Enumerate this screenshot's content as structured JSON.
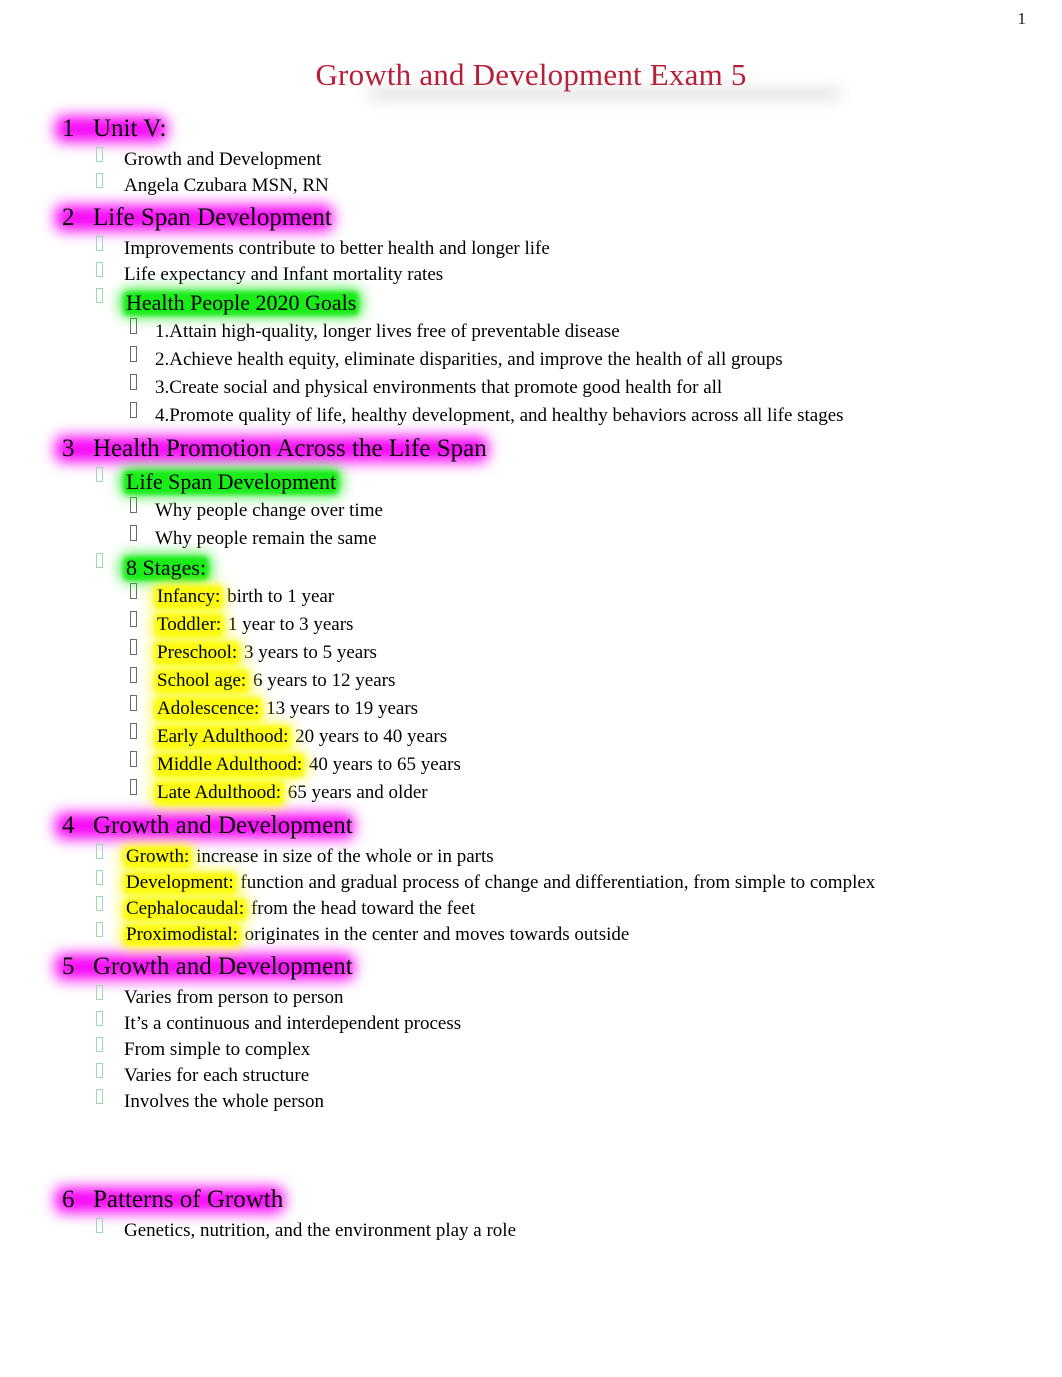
{
  "page": {
    "number": "1",
    "title": "Growth and Development Exam 5",
    "title_color": "#b81e38",
    "highlight_colors": {
      "magenta": "#FF00FF",
      "green": "#00FF00",
      "yellow": "#FFFF00"
    }
  },
  "sections": [
    {
      "number": "1",
      "heading": "Unit V:",
      "heading_highlight": "magenta",
      "items": [
        {
          "level": 2,
          "text": "Growth and Development"
        },
        {
          "level": 2,
          "text": "Angela Czubara MSN, RN"
        }
      ]
    },
    {
      "number": "2",
      "heading": "Life Span Development",
      "heading_highlight": "magenta",
      "items": [
        {
          "level": 2,
          "text": "Improvements contribute to better health and longer life"
        },
        {
          "level": 2,
          "text": "Life expectancy and Infant mortality rates"
        },
        {
          "level": 2,
          "text": "Health People 2020 Goals",
          "highlight": "green",
          "big": true
        },
        {
          "level": 3,
          "text": "1.Attain high-quality, longer lives free of preventable disease"
        },
        {
          "level": 3,
          "text": "2.Achieve health equity, eliminate disparities, and improve the health of all groups"
        },
        {
          "level": 3,
          "text": "3.Create social and physical environments that promote good health for all"
        },
        {
          "level": 3,
          "text": "4.Promote quality of life, healthy development, and healthy behaviors across all life stages"
        }
      ]
    },
    {
      "number": "3",
      "heading": "Health Promotion Across the Life Span",
      "heading_highlight": "magenta",
      "items": [
        {
          "level": 2,
          "text": "Life Span Development",
          "highlight": "green",
          "big": true
        },
        {
          "level": 3,
          "text": "Why people change over time"
        },
        {
          "level": 3,
          "text": "Why people remain the same"
        },
        {
          "level": 2,
          "text": "8 Stages:",
          "highlight": "green",
          "big": true
        },
        {
          "level": 3,
          "term": "Infancy:",
          "term_highlight": "yellow",
          "rest": " birth to 1 year"
        },
        {
          "level": 3,
          "term": "Toddler:",
          "term_highlight": "yellow",
          "rest": "  1 year to 3 years"
        },
        {
          "level": 3,
          "term": "Preschool:",
          "term_highlight": "yellow",
          "rest": "  3 years to 5 years"
        },
        {
          "level": 3,
          "term": "School age:",
          "term_highlight": "yellow",
          "rest": " 6 years to 12 years"
        },
        {
          "level": 3,
          "term": "Adolescence:",
          "term_highlight": "yellow",
          "rest": " 13 years to 19 years"
        },
        {
          "level": 3,
          "term": "Early Adulthood:",
          "term_highlight": "yellow",
          "rest": " 20 years to 40 years"
        },
        {
          "level": 3,
          "term": "Middle Adulthood:",
          "term_highlight": "yellow",
          "rest": "  40 years to 65 years"
        },
        {
          "level": 3,
          "term": "Late Adulthood:",
          "term_highlight": "yellow",
          "rest": "  65 years and older"
        }
      ]
    },
    {
      "number": "4",
      "heading": "Growth and Development",
      "heading_highlight": "magenta",
      "items": [
        {
          "level": 2,
          "term": "Growth:",
          "term_highlight": "yellow",
          "rest": " increase in size of the whole or in parts"
        },
        {
          "level": 2,
          "term": "Development:",
          "term_highlight": "yellow",
          "rest": "  function and gradual process of change and differentiation, from simple to complex"
        },
        {
          "level": 2,
          "term": "Cephalocaudal:",
          "term_highlight": "yellow",
          "rest": "  from the head toward the feet"
        },
        {
          "level": 2,
          "term": "Proximodistal:",
          "term_highlight": "yellow",
          "rest": " originates in the center and moves towards outside"
        }
      ]
    },
    {
      "number": "5",
      "heading": "Growth and Development",
      "heading_highlight": "magenta",
      "items": [
        {
          "level": 2,
          "text": "Varies from person to person"
        },
        {
          "level": 2,
          "text": "It’s a continuous and interdependent process"
        },
        {
          "level": 2,
          "text": "From simple to complex"
        },
        {
          "level": 2,
          "text": "Varies for each structure"
        },
        {
          "level": 2,
          "text": "Involves the whole person"
        }
      ]
    },
    {
      "number": "6",
      "heading": "Patterns of Growth",
      "heading_highlight": "magenta",
      "items": [
        {
          "level": 2,
          "text": "Genetics, nutrition, and the environment play a role"
        }
      ]
    }
  ]
}
